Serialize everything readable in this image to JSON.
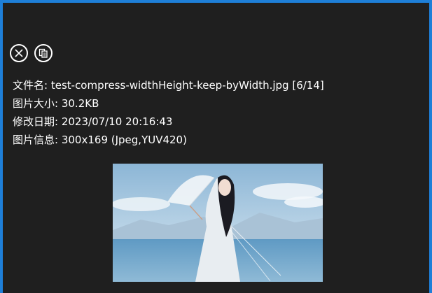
{
  "toolbar": {
    "close_icon": "close-icon",
    "copy_icon": "copy-icon"
  },
  "info": {
    "filename_label": "文件名:",
    "filename_value": "test-compress-widthHeight-keep-byWidth.jpg [6/14]",
    "size_label": "图片大小:",
    "size_value": "30.2KB",
    "date_label": "修改日期:",
    "date_value": "2023/07/10 20:16:43",
    "meta_label": "图片信息:",
    "meta_value": "300x169 (Jpeg,YUV420)"
  },
  "colors": {
    "accent_border": "#1e7fd8",
    "background": "#1f1f1f",
    "text": "#ffffff"
  }
}
